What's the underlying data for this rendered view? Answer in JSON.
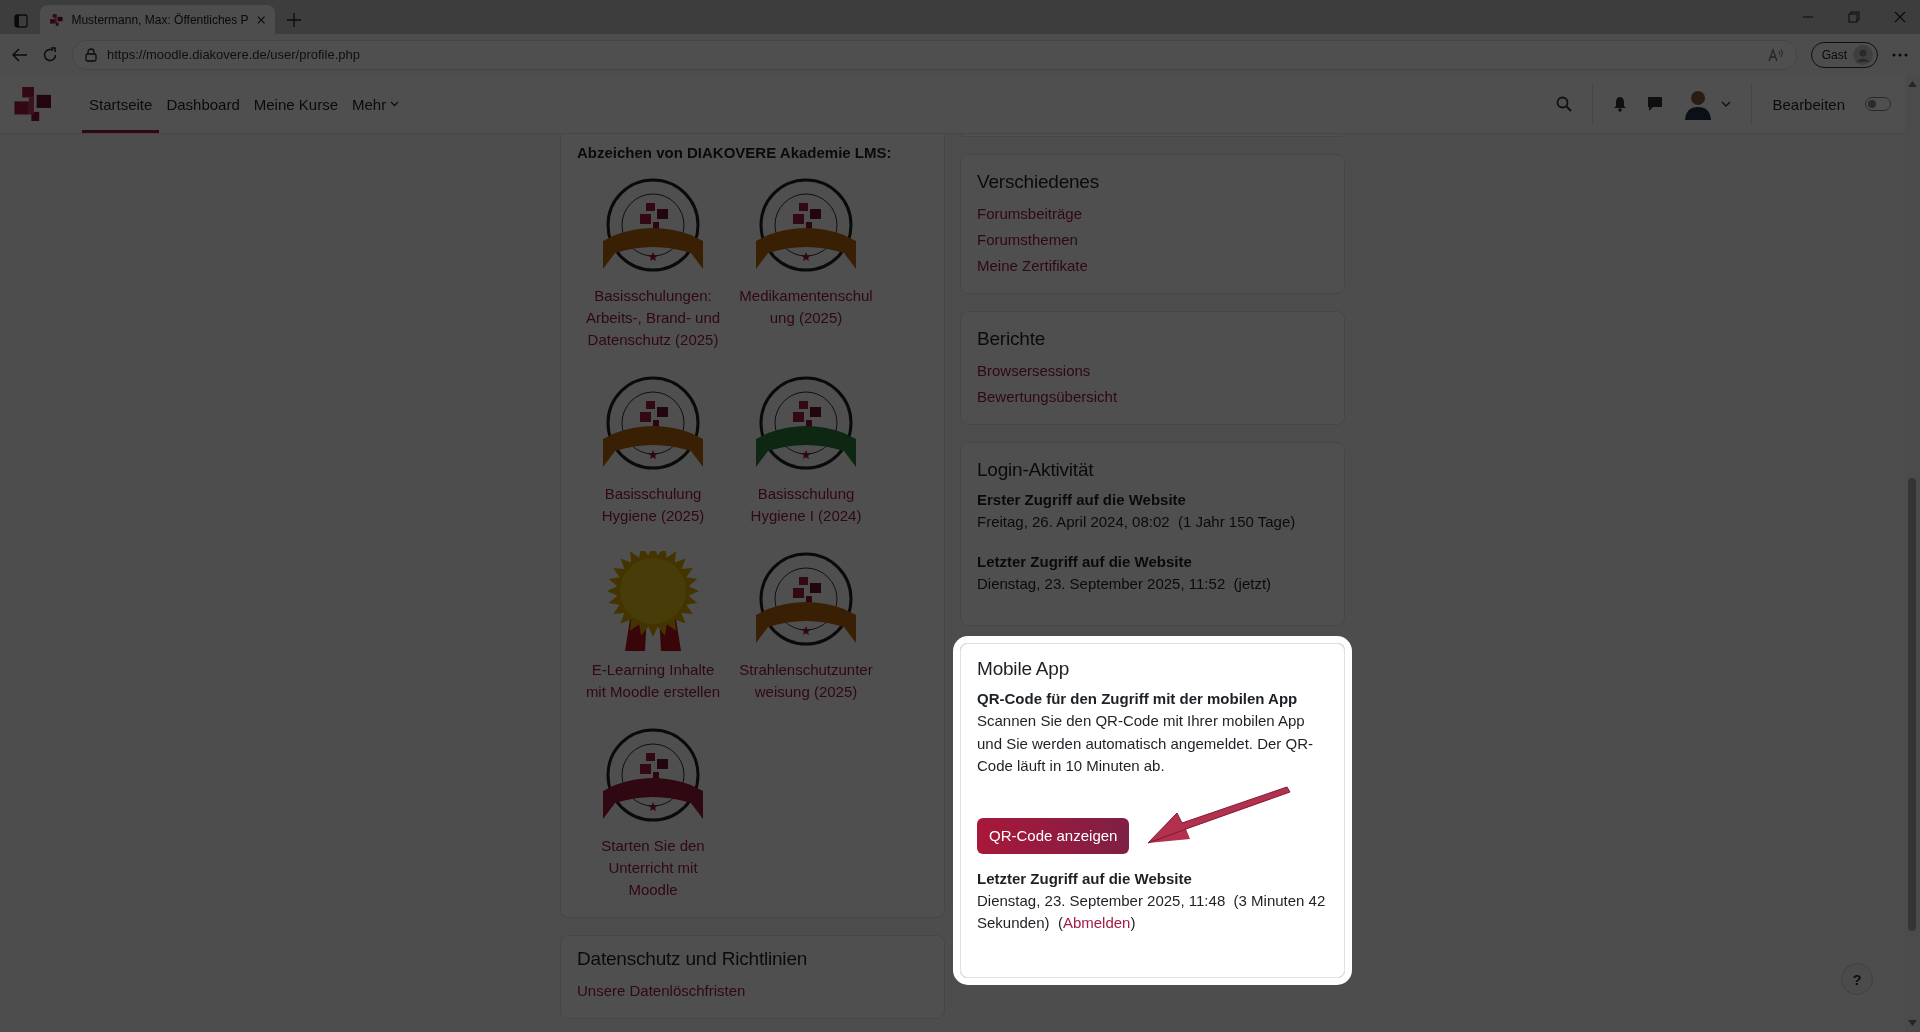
{
  "browser": {
    "tab_title": "Mustermann, Max: Öffentliches P",
    "url": "https://moodle.diakovere.de/user/profile.php",
    "profile": "Gast"
  },
  "navbar": {
    "items": [
      {
        "label": "Startseite",
        "selected": true,
        "kind": "link"
      },
      {
        "label": "Dashboard",
        "selected": false,
        "kind": "link"
      },
      {
        "label": "Meine Kurse",
        "selected": false,
        "kind": "link"
      },
      {
        "label": "Mehr",
        "selected": false,
        "kind": "dropdown"
      }
    ],
    "edit_label": "Bearbeiten",
    "edit_mode": false
  },
  "badges": {
    "heading": "Abzeichen von DIAKOVERE Akademie LMS:",
    "items": [
      {
        "label": "Basisschulungen: Arbeits-, Brand- und Datenschutz (2025)",
        "kind": "bronze"
      },
      {
        "label": "Medikamentenschulung (2025)",
        "kind": "bronze"
      },
      {
        "label": "Basisschulung Hygiene (2025)",
        "kind": "bronze"
      },
      {
        "label": "Basisschulung Hygiene I (2024)",
        "kind": "green"
      },
      {
        "label": "E-Learning Inhalte mit Moodle erstellen",
        "kind": "medal"
      },
      {
        "label": "Strahlenschutzunterweisung (2025)",
        "kind": "bronze"
      },
      {
        "label": "Starten Sie den Unterricht mit Moodle",
        "kind": "crimson"
      }
    ]
  },
  "privacy": {
    "title": "Datenschutz und Richtlinien",
    "links": [
      "Unsere Datenlöschfristen"
    ]
  },
  "misc": {
    "title": "Verschiedenes",
    "links": [
      "Forumsbeiträge",
      "Forumsthemen",
      "Meine Zertifikate"
    ]
  },
  "reports": {
    "title": "Berichte",
    "links": [
      "Browsersessions",
      "Bewertungsübersicht"
    ]
  },
  "login": {
    "title": "Login-Aktivität",
    "entries": [
      {
        "label": "Erster Zugriff auf die Website",
        "value": "Freitag, 26. April 2024, 08:02  (1 Jahr 150 Tage)"
      },
      {
        "label": "Letzter Zugriff auf die Website",
        "value": "Dienstag, 23. September 2025, 11:52  (jetzt)"
      }
    ]
  },
  "mobile_app": {
    "title": "Mobile App",
    "heading": "QR-Code für den Zugriff mit der mobilen App",
    "text": "Scannen Sie den QR-Code mit Ihrer mobilen App und Sie werden automatisch angemeldet. Der QR-Code läuft in 10 Minuten ab.",
    "button": "QR-Code anzeigen",
    "last_access": {
      "label": "Letzter Zugriff auf die Website",
      "text": "Dienstag, 23. September 2025, 11:48  (3 Minuten 42 Sekunden)  (",
      "link": "Abmelden",
      "after": ")"
    }
  },
  "help_button": "?"
}
